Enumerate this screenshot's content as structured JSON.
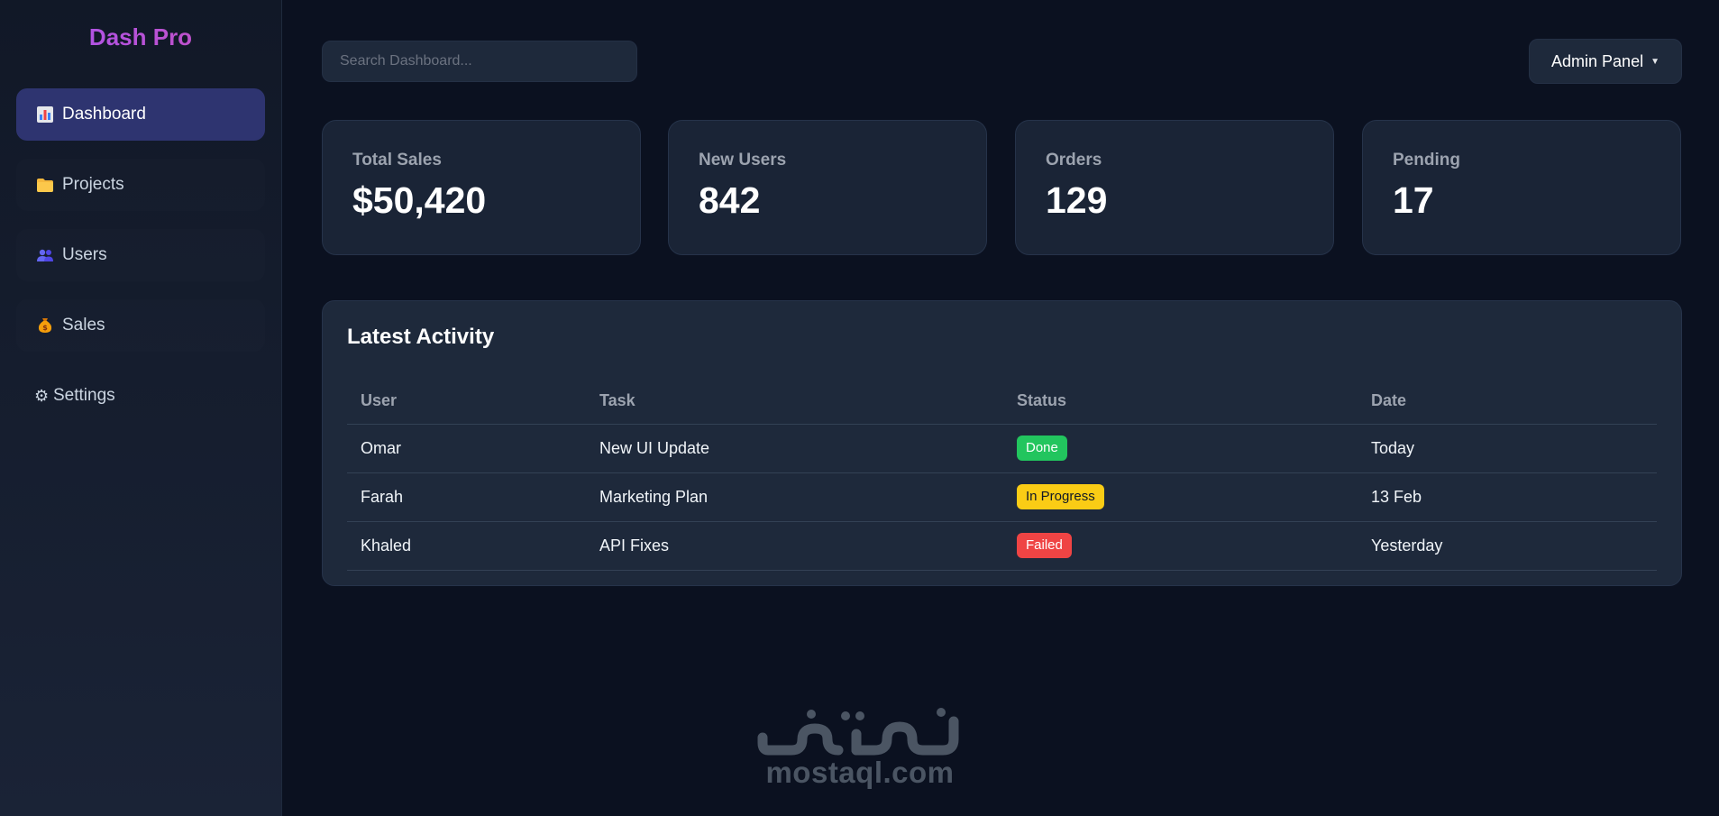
{
  "brand": "Dash Pro",
  "sidebar": {
    "items": [
      {
        "label": "Dashboard",
        "icon": "bar-chart-icon",
        "active": true
      },
      {
        "label": "Projects",
        "icon": "folder-icon"
      },
      {
        "label": "Users",
        "icon": "users-icon"
      },
      {
        "label": "Sales",
        "icon": "money-bag-icon"
      },
      {
        "label": "Settings",
        "icon": "gear-icon"
      }
    ]
  },
  "header": {
    "search_placeholder": "Search Dashboard...",
    "admin_label": "Admin Panel"
  },
  "stats": [
    {
      "label": "Total Sales",
      "value": "$50,420"
    },
    {
      "label": "New Users",
      "value": "842"
    },
    {
      "label": "Orders",
      "value": "129"
    },
    {
      "label": "Pending",
      "value": "17"
    }
  ],
  "activity": {
    "title": "Latest Activity",
    "columns": [
      "User",
      "Task",
      "Status",
      "Date"
    ],
    "rows": [
      {
        "user": "Omar",
        "task": "New UI Update",
        "status": "Done",
        "date": "Today"
      },
      {
        "user": "Farah",
        "task": "Marketing Plan",
        "status": "In Progress",
        "date": "13 Feb"
      },
      {
        "user": "Khaled",
        "task": "API Fixes",
        "status": "Failed",
        "date": "Yesterday"
      }
    ]
  },
  "colors": {
    "accent": "#a855f7",
    "active_nav": "#2e3470",
    "done": "#22c55e",
    "in_progress": "#facc15",
    "failed": "#ef4444"
  },
  "watermark": {
    "arabic": "مستقل",
    "latin": "mostaql.com"
  }
}
